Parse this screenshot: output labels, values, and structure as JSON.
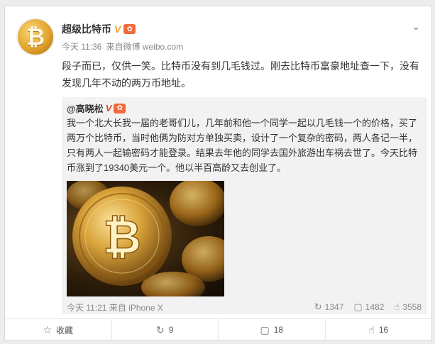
{
  "post": {
    "author": "超级比特币",
    "verified_badge": "V",
    "level_badge": "✿",
    "time": "今天 11:36",
    "source_prefix": "来自",
    "source": "微博 weibo.com",
    "text": "段子而已，仅供一笑。比特币没有到几毛钱过。刚去比特币富豪地址查一下，没有发现几年不动的两万币地址。"
  },
  "quoted": {
    "author": "@高晓松",
    "verified_badge": "V",
    "level_badge": "✿",
    "text": "我一个北大长我一届的老哥们儿，几年前和他一个同学一起以几毛钱一个的价格，买了两万个比特币，当时他俩为防对方单独买卖，设计了一个复杂的密码，两人各记一半，只有两人一起输密码才能登录。结果去年他的同学去国外旅游出车祸去世了。今天比特币涨到了19340美元一个。他以半百高龄又去创业了。",
    "time": "今天 11:21",
    "source_prefix": "来自",
    "source": "iPhone X",
    "reposts": "1347",
    "comments": "1482",
    "likes": "3558"
  },
  "actions": {
    "favorite": "收藏",
    "repost": "9",
    "comment": "18",
    "like": "16"
  },
  "colors": {
    "accent": "#f0a02c",
    "background": "#ededed",
    "quote_bg": "#f2f2f2"
  }
}
